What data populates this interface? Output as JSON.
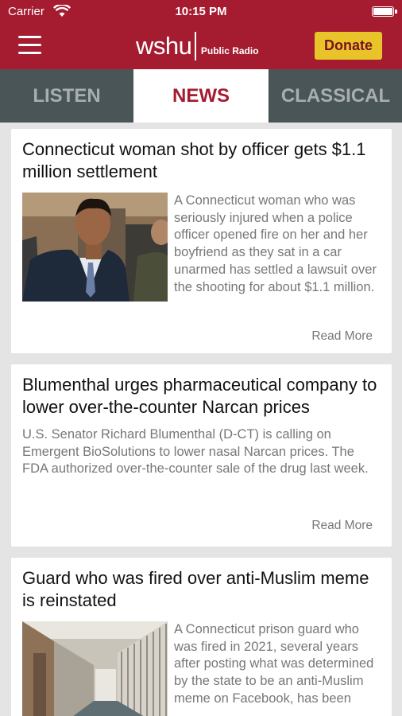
{
  "status_bar": {
    "carrier": "Carrier",
    "time": "10:15 PM"
  },
  "app_bar": {
    "brand": "wshu",
    "brand_sub": "Public Radio",
    "donate_label": "Donate"
  },
  "tabs": [
    {
      "label": "LISTEN",
      "active": false
    },
    {
      "label": "NEWS",
      "active": true
    },
    {
      "label": "CLASSICAL",
      "active": false
    }
  ],
  "articles": [
    {
      "title": "Connecticut woman shot by officer gets $1.1 million settlement",
      "summary": "A Connecticut woman who was seriously injured when a police officer opened fire on her and her boyfriend as they sat in a car unarmed has settled a lawsuit over the shooting for about $1.1 million.",
      "read_more": "Read More"
    },
    {
      "title": "Blumenthal urges pharmaceutical company to lower over-the-counter Narcan prices",
      "summary": "U.S. Senator Richard Blumenthal (D-CT) is calling on Emergent BioSolutions to lower nasal Narcan prices. The FDA authorized over-the-counter sale of the drug last week.",
      "read_more": "Read More"
    },
    {
      "title": "Guard who was fired over anti-Muslim meme is reinstated",
      "summary": "A Connecticut prison guard who was fired in 2021, several years after posting what was determined by the state to be an anti-Muslim meme on Facebook, has been"
    }
  ],
  "colors": {
    "brand_red": "#a51c30",
    "donate_yellow": "#e8c42a",
    "tab_gray": "#4a5558"
  }
}
